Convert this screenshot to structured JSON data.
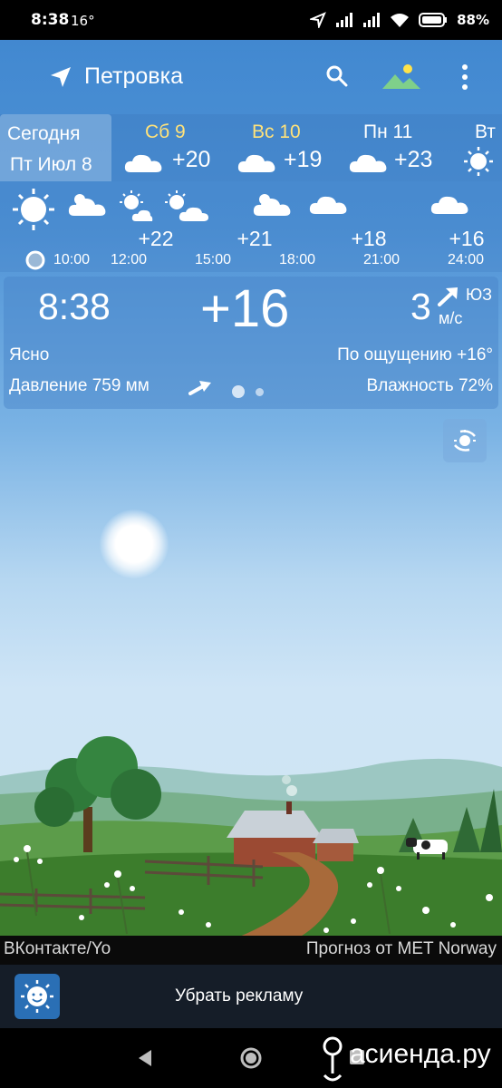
{
  "status_bar": {
    "time": "8:38",
    "temp": "16°",
    "battery": "88%"
  },
  "header": {
    "location": "Петровка",
    "icons": [
      "location-arrow-icon",
      "search-icon",
      "landscape-icon",
      "more-vert-icon"
    ]
  },
  "days": [
    {
      "name": "Сегодня",
      "sub": "Пт Июл 8",
      "temp": "",
      "weekend": false
    },
    {
      "name": "Сб 9",
      "temp": "+20",
      "icon": "cloud-icon",
      "weekend": true
    },
    {
      "name": "Вс 10",
      "temp": "+19",
      "icon": "cloud-icon",
      "weekend": true
    },
    {
      "name": "Пн 11",
      "temp": "+23",
      "icon": "cloud-icon",
      "weekend": false
    },
    {
      "name": "Вт",
      "temp": "",
      "icon": "sun-icon",
      "weekend": false
    }
  ],
  "hourly": {
    "temps": [
      {
        "value": "+22"
      },
      {
        "value": "+21"
      },
      {
        "value": "+18"
      },
      {
        "value": "+16"
      }
    ],
    "times": [
      "10:00",
      "12:00",
      "15:00",
      "18:00",
      "21:00",
      "24:00"
    ]
  },
  "current": {
    "time": "8:38",
    "temperature": "+16",
    "wind_speed": "3",
    "wind_dir": "ЮЗ",
    "wind_unit": "м/с",
    "condition": "Ясно",
    "feels_like": "По ощущению +16°",
    "pressure": "Давление 759 мм",
    "humidity": "Влажность 72%",
    "page_indicator": {
      "count": 2,
      "active": 0
    }
  },
  "footer": {
    "credit_left": "ВКонтакте/Yo",
    "credit_right": "Прогноз от MET Norway",
    "ad_remove": "Убрать рекламу"
  },
  "watermark": {
    "text": "асиенда.ру"
  },
  "colors": {
    "sky_top": "#3f86cf",
    "weekend_text": "#ffe27a",
    "ad_bar": "#151d28"
  }
}
